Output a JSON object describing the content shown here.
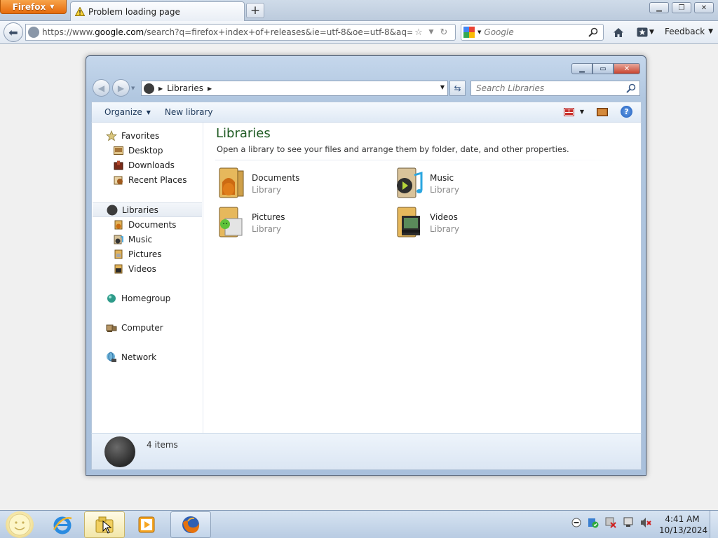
{
  "firefox": {
    "menu_label": "Firefox",
    "tab_title": "Problem loading page",
    "url": "https://www.google.com/search?q=firefox+index+of+releases&ie=utf-8&oe=utf-8&aq=t&rls=org.",
    "url_scheme": "https://www.",
    "url_domain": "google.com",
    "url_rest": "/search?q=firefox+index+of+releases&ie=utf-8&oe=utf-8&aq=t&rls=org.",
    "search_placeholder": "Google",
    "feedback_label": "Feedback"
  },
  "explorer": {
    "breadcrumb": "Libraries",
    "search_placeholder": "Search Libraries",
    "toolbar": {
      "organize": "Organize",
      "new_library": "New library"
    },
    "nav": {
      "favorites": "Favorites",
      "favorites_items": [
        "Desktop",
        "Downloads",
        "Recent Places"
      ],
      "libraries": "Libraries",
      "libraries_items": [
        "Documents",
        "Music",
        "Pictures",
        "Videos"
      ],
      "homegroup": "Homegroup",
      "computer": "Computer",
      "network": "Network"
    },
    "content": {
      "title": "Libraries",
      "description": "Open a library to see your files and arrange them by folder, date, and other properties.",
      "libraries": [
        {
          "name": "Documents",
          "type": "Library"
        },
        {
          "name": "Music",
          "type": "Library"
        },
        {
          "name": "Pictures",
          "type": "Library"
        },
        {
          "name": "Videos",
          "type": "Library"
        }
      ]
    },
    "details": {
      "count": "4 items"
    }
  },
  "taskbar": {
    "time": "4:41 AM",
    "date": "10/13/2024"
  },
  "colors": {
    "firefox_orange": "#e66b0b",
    "library_title_green": "#1e5a22",
    "close_red": "#c9432e"
  }
}
